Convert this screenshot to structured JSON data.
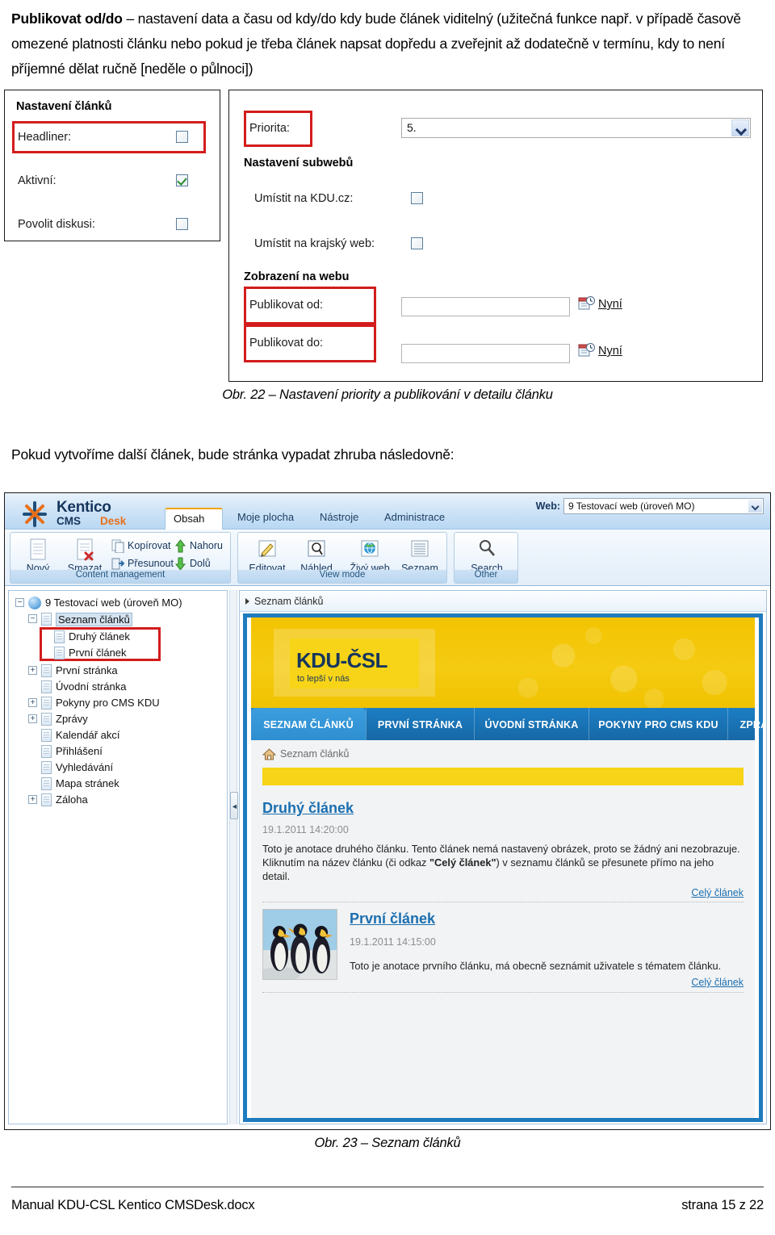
{
  "document": {
    "intro_paragraph_html": "<b>Publikovat od/do</b> – nastavení data a času od kdy/do kdy bude článek viditelný (užitečná funkce např. v případě časově omezené platnosti článku nebo pokud je třeba článek napsat dopředu a zveřejnit až dodatečně v termínu, kdy to není příjemné dělat ručně [neděle o půlnoci])",
    "caption_22": "Obr. 22 – Nastavení priority a publikování v detailu článku",
    "middle_paragraph": "Pokud vytvoříme další článek, bude stránka vypadat zhruba následovně:",
    "caption_23": "Obr. 23 – Seznam článků",
    "footer_left": "Manual KDU-CSL Kentico CMSDesk.docx",
    "footer_right": "strana 15 z 22"
  },
  "figure22": {
    "left_panel": {
      "heading": "Nastavení článků",
      "fields": [
        {
          "label": "Headliner:",
          "checked": false,
          "highlighted": true
        },
        {
          "label": "Aktivní:",
          "checked": true,
          "highlighted": false
        },
        {
          "label": "Povolit diskusi:",
          "checked": false,
          "highlighted": false
        }
      ]
    },
    "right_panel": {
      "priority_label": "Priorita:",
      "priority_value": "5.",
      "subweb_heading": "Nastavení subwebů",
      "subweb_fields": [
        {
          "label": "Umístit na KDU.cz:",
          "checked": false
        },
        {
          "label": "Umístit na krajský web:",
          "checked": false
        }
      ],
      "display_heading": "Zobrazení na webu",
      "publish_fields": [
        {
          "label": "Publikovat od:",
          "value": "",
          "now_link": "Nyní"
        },
        {
          "label": "Publikovat do:",
          "value": "",
          "now_link": "Nyní"
        }
      ]
    },
    "highlight_color": "#d31c1c"
  },
  "kentico": {
    "brand": {
      "line1": "Kentico",
      "line2a": "CMS ",
      "line2b": "Desk"
    },
    "tabs": [
      {
        "label": "Obsah",
        "active": true
      },
      {
        "label": "Moje plocha",
        "active": false
      },
      {
        "label": "Nástroje",
        "active": false
      },
      {
        "label": "Administrace",
        "active": false
      }
    ],
    "web_selector": {
      "label": "Web:",
      "value": "9 Testovací web (úroveň MO)"
    },
    "ribbon_groups": [
      {
        "title": "Content management",
        "big_items": [
          {
            "label": "Nový",
            "icon": "new-page-icon"
          },
          {
            "label": "Smazat",
            "icon": "delete-page-icon"
          }
        ],
        "small_items": [
          {
            "label": "Kopírovat",
            "icon": "copy-icon"
          },
          {
            "label": "Přesunout",
            "icon": "move-icon"
          },
          {
            "label": "Nahoru",
            "icon": "arrow-up-icon"
          },
          {
            "label": "Dolů",
            "icon": "arrow-down-icon"
          }
        ]
      },
      {
        "title": "View mode",
        "big_items": [
          {
            "label": "Editovat",
            "icon": "edit-icon",
            "selected": false
          },
          {
            "label": "Náhled",
            "icon": "preview-icon",
            "selected": true
          },
          {
            "label": "Živý web",
            "icon": "live-site-icon",
            "selected": false
          },
          {
            "label": "Seznam",
            "icon": "list-icon",
            "selected": false
          }
        ],
        "small_items": []
      },
      {
        "title": "Other",
        "big_items": [
          {
            "label": "Search",
            "icon": "search-icon",
            "selected": false
          }
        ],
        "small_items": []
      }
    ],
    "view_mode_labels": {
      "zivy_web": "Živý web"
    },
    "tree": [
      {
        "label": "9 Testovací web (úroveň MO)",
        "depth": 0,
        "icon": "globe-icon",
        "expander": "minus",
        "selected": false,
        "highlighted": false
      },
      {
        "label": "Seznam článků",
        "depth": 1,
        "icon": "page-icon",
        "expander": "minus",
        "selected": true,
        "highlighted": false
      },
      {
        "label": "Druhý článek",
        "depth": 2,
        "icon": "page-icon",
        "expander": "none",
        "selected": false,
        "highlighted": true
      },
      {
        "label": "První článek",
        "depth": 2,
        "icon": "page-icon",
        "expander": "none",
        "selected": false,
        "highlighted": true
      },
      {
        "label": "První stránka",
        "depth": 1,
        "icon": "page-icon",
        "expander": "plus",
        "selected": false,
        "highlighted": false
      },
      {
        "label": "Úvodní stránka",
        "depth": 1,
        "icon": "page-icon",
        "expander": "none",
        "selected": false,
        "highlighted": false
      },
      {
        "label": "Pokyny pro CMS KDU",
        "depth": 1,
        "icon": "page-icon",
        "expander": "plus",
        "selected": false,
        "highlighted": false
      },
      {
        "label": "Zprávy",
        "depth": 1,
        "icon": "page-icon",
        "expander": "plus",
        "selected": false,
        "highlighted": false
      },
      {
        "label": "Kalendář akcí",
        "depth": 1,
        "icon": "page-icon",
        "expander": "none",
        "selected": false,
        "highlighted": false
      },
      {
        "label": "Přihlášení",
        "depth": 1,
        "icon": "page-icon",
        "expander": "none",
        "selected": false,
        "highlighted": false
      },
      {
        "label": "Vyhledávání",
        "depth": 1,
        "icon": "page-icon",
        "expander": "none",
        "selected": false,
        "highlighted": false
      },
      {
        "label": "Mapa stránek",
        "depth": 1,
        "icon": "page-icon",
        "expander": "none",
        "selected": false,
        "highlighted": false
      },
      {
        "label": "Záloha",
        "depth": 1,
        "icon": "page-icon",
        "expander": "plus",
        "selected": false,
        "highlighted": false
      }
    ],
    "splitter_handle": "◄",
    "breadcrumb": "Seznam článků",
    "site": {
      "logo": {
        "title": "KDU-ČSL",
        "slogan": "to lepší v nás"
      },
      "nav": [
        {
          "label": "SEZNAM ČLÁNKŮ",
          "active": true
        },
        {
          "label": "PRVNÍ STRÁNKA",
          "active": false
        },
        {
          "label": "ÚVODNÍ STRÁNKA",
          "active": false
        },
        {
          "label": "POKYNY PRO CMS KDU",
          "active": false
        },
        {
          "label": "ZPRÁVY",
          "active": false
        }
      ],
      "home_crumb": "Seznam článků",
      "articles": [
        {
          "title": "Druhý článek",
          "date": "19.1.2011 14:20:00",
          "body_html": "Toto je anotace druhého článku. Tento článek nemá nastavený obrázek, proto se žádný ani nezobrazuje.<br>Kliknutím na název článku (či odkaz <b>\"Celý článek\"</b>) v seznamu článků se přesunete přímo na jeho detail.",
          "more_link": "Celý článek",
          "has_image": false
        },
        {
          "title": "První článek",
          "date": "19.1.2011 14:15:00",
          "body_html": "Toto je anotace prvního článku, má obecně seznámit uživatele s tématem článku.",
          "more_link": "Celý článek",
          "has_image": true,
          "image_alt": "penguins-thumbnail"
        }
      ]
    }
  },
  "colors": {
    "brand_yellow": "#f2c300",
    "brand_blue": "#1f7bbf",
    "kentico_orange": "#e8701a",
    "highlight_red": "#d31c1c",
    "link_blue": "#1b6fb0"
  }
}
